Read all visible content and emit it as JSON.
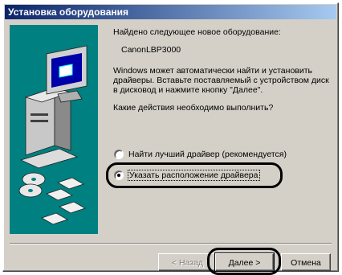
{
  "window": {
    "title": "Установка оборудования"
  },
  "content": {
    "found_text": "Найдено следующее новое оборудование:",
    "device_name": "CanonLBP3000",
    "description": "Windows может автоматически найти и установить драйверы. Вставьте поставляемый с устройством диск в дисковод и нажмите кнопку \"Далее\".",
    "question": "Какие действия необходимо выполнить?",
    "options": [
      {
        "label": "Найти лучший драйвер (рекомендуется)",
        "checked": false
      },
      {
        "label": "Указать расположение драйвера",
        "checked": true
      }
    ]
  },
  "buttons": {
    "back": "< Назад",
    "next": "Далее >",
    "cancel": "Отмена"
  },
  "colors": {
    "title_start": "#0a246a",
    "title_end": "#a6caf0",
    "art_bg": "#008080",
    "face": "#d4d0c8"
  },
  "icons": [
    "computer-icon",
    "monitor-icon",
    "cd-icon",
    "diskette-icon"
  ]
}
